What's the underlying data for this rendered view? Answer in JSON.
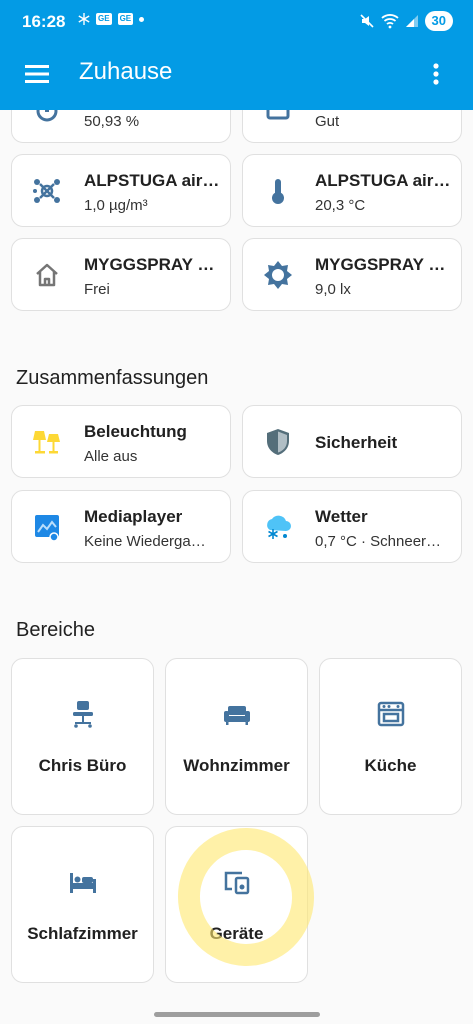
{
  "status": {
    "time": "16:28",
    "badge1": "GE",
    "badge2": "GE",
    "battery": "30"
  },
  "toolbar": {
    "title": "Zuhause"
  },
  "tiles": [
    {
      "name": "",
      "state": "50,93 %",
      "icon": "humidity-icon"
    },
    {
      "name": "",
      "state": "Gut",
      "icon": "air-quality-icon"
    },
    {
      "name": "ALPSTUGA air…",
      "state": "1,0 µg/m³",
      "icon": "molecule-icon"
    },
    {
      "name": "ALPSTUGA air…",
      "state": "20,3 °C",
      "icon": "thermometer-icon"
    },
    {
      "name": "MYGGSPRAY …",
      "state": "Frei",
      "icon": "home-outline-icon"
    },
    {
      "name": "MYGGSPRAY …",
      "state": "9,0 lx",
      "icon": "brightness-icon"
    }
  ],
  "summaries": {
    "title": "Zusammenfassungen",
    "items": [
      {
        "name": "Beleuchtung",
        "state": "Alle aus",
        "icon": "lamps-icon"
      },
      {
        "name": "Sicherheit",
        "state": "",
        "icon": "shield-icon"
      },
      {
        "name": "Mediaplayer",
        "state": "Keine Wiederga…",
        "icon": "media-icon"
      },
      {
        "name": "Wetter",
        "state": "0,7 °C · Schneer…",
        "icon": "weather-snow-icon"
      }
    ]
  },
  "areas": {
    "title": "Bereiche",
    "items": [
      {
        "name": "Chris Büro",
        "icon": "desk-chair-icon"
      },
      {
        "name": "Wohnzimmer",
        "icon": "sofa-icon"
      },
      {
        "name": "Küche",
        "icon": "stove-icon"
      },
      {
        "name": "Schlafzimmer",
        "icon": "bed-icon"
      },
      {
        "name": "Geräte",
        "icon": "devices-icon"
      }
    ]
  },
  "colors": {
    "appbar": "#039be5",
    "icon_blue": "#44739e",
    "lamp_yellow": "#fdd835",
    "weather_blue": "#4fc3f7",
    "highlight": "#ffe86e"
  }
}
